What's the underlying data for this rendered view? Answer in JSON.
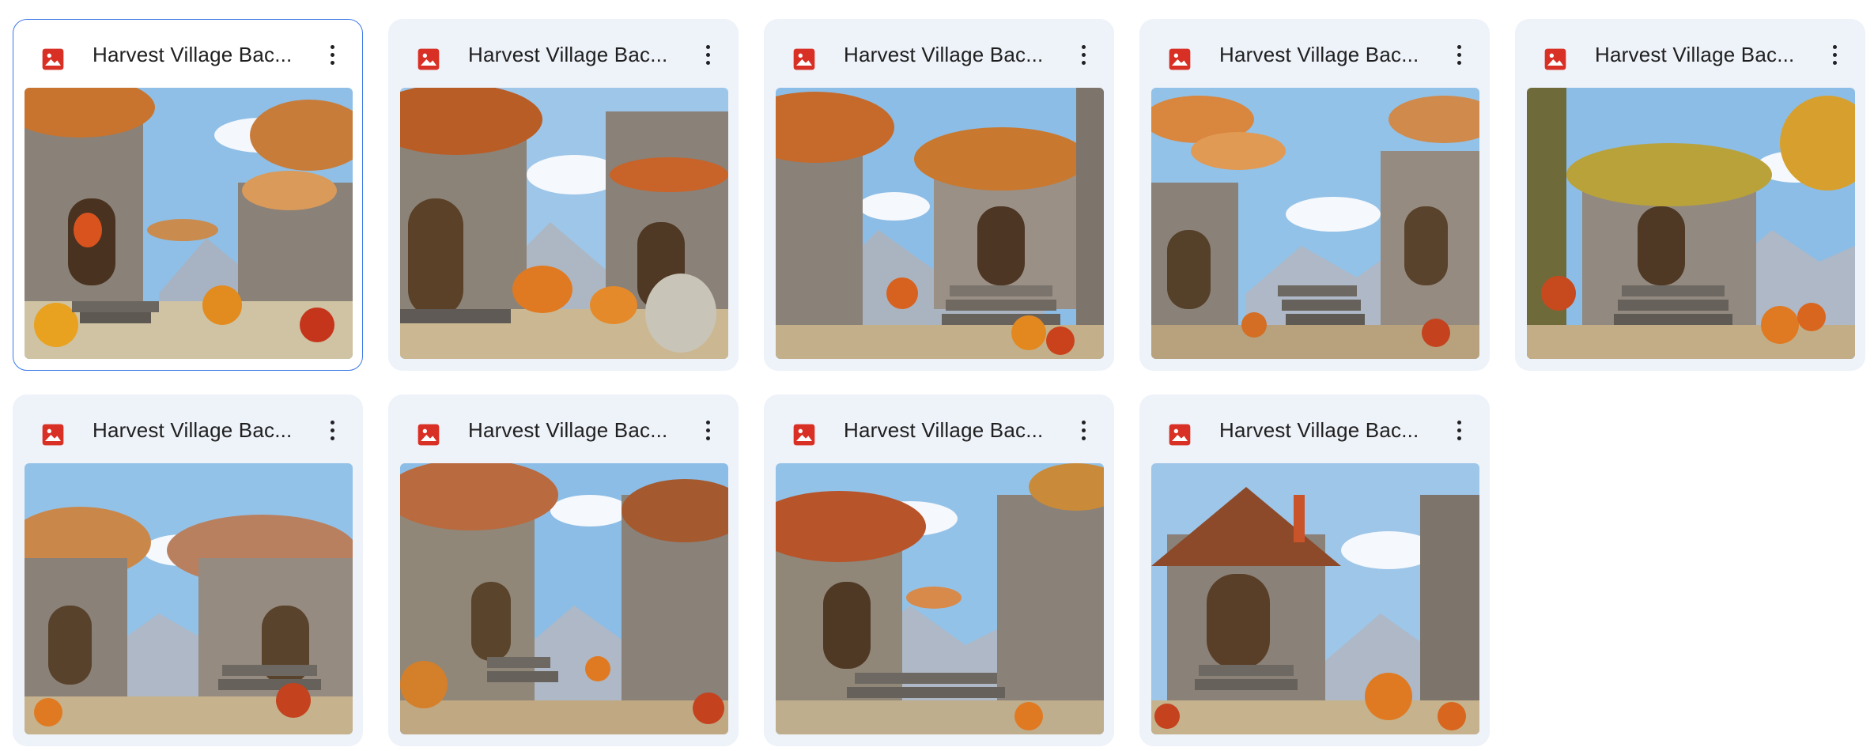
{
  "files": [
    {
      "name": "Harvest Village Bac...",
      "icon": "image-file-icon",
      "selected": true
    },
    {
      "name": "Harvest Village Bac...",
      "icon": "image-file-icon",
      "selected": false
    },
    {
      "name": "Harvest Village Bac...",
      "icon": "image-file-icon",
      "selected": false
    },
    {
      "name": "Harvest Village Bac...",
      "icon": "image-file-icon",
      "selected": false
    },
    {
      "name": "Harvest Village Bac...",
      "icon": "image-file-icon",
      "selected": false
    },
    {
      "name": "Harvest Village Bac...",
      "icon": "image-file-icon",
      "selected": false
    },
    {
      "name": "Harvest Village Bac...",
      "icon": "image-file-icon",
      "selected": false
    },
    {
      "name": "Harvest Village Bac...",
      "icon": "image-file-icon",
      "selected": false
    },
    {
      "name": "Harvest Village Bac...",
      "icon": "image-file-icon",
      "selected": false
    }
  ],
  "colors": {
    "card_bg": "#eef2f9",
    "selected_border": "#3b78e7",
    "image_icon_red": "#d93025",
    "sky": "#8fbfe6",
    "pumpkin": "#e07a22",
    "stone": "#8a8178"
  }
}
